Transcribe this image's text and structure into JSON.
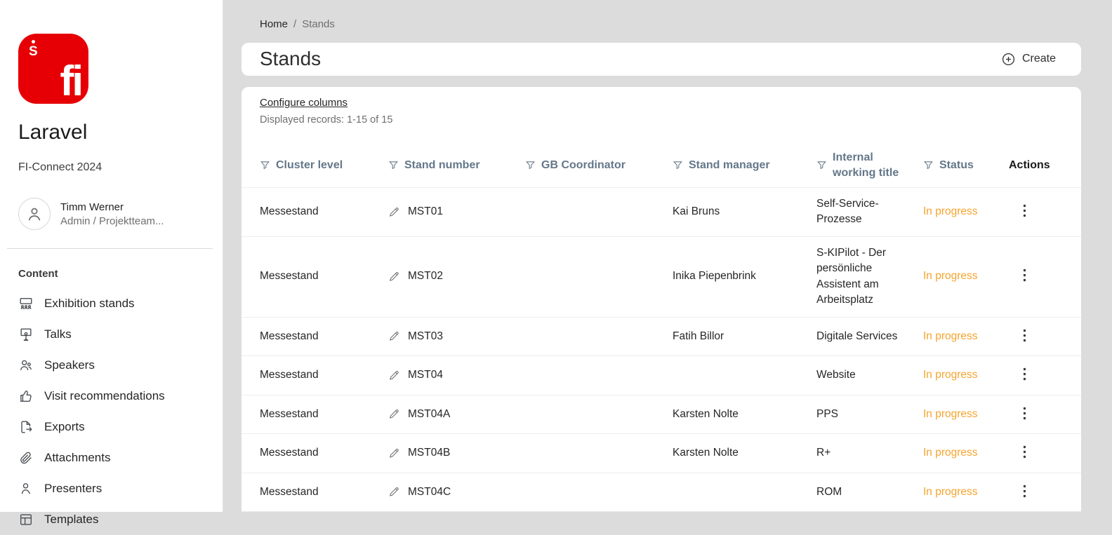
{
  "colors": {
    "brand_red": "#e60005",
    "status_orange": "#f5a42d",
    "window_bg": "#dcdcdc",
    "header_text": "#64778a"
  },
  "sidebar": {
    "logo": {
      "mark": "S",
      "text": "fi"
    },
    "app_title": "Laravel",
    "subtitle": "FI-Connect 2024",
    "user": {
      "name": "Timm Werner",
      "role": "Admin / Projektteam..."
    },
    "section": "Content",
    "items": [
      {
        "label": "Exhibition stands",
        "icon": "exhibition-stands-icon"
      },
      {
        "label": "Talks",
        "icon": "talks-icon"
      },
      {
        "label": "Speakers",
        "icon": "speakers-icon"
      },
      {
        "label": "Visit recommendations",
        "icon": "thumbs-up-icon"
      },
      {
        "label": "Exports",
        "icon": "export-icon"
      },
      {
        "label": "Attachments",
        "icon": "paperclip-icon"
      },
      {
        "label": "Presenters",
        "icon": "presenter-icon"
      },
      {
        "label": "Templates",
        "icon": "templates-icon"
      }
    ]
  },
  "breadcrumb": {
    "home": "Home",
    "separator": "/",
    "current": "Stands"
  },
  "page": {
    "title": "Stands",
    "create_label": "Create"
  },
  "table": {
    "configure_columns_label": "Configure columns",
    "records_info": "Displayed records: 1-15 of 15",
    "columns": [
      {
        "label": "Cluster level",
        "filterable": true
      },
      {
        "label": "Stand number",
        "filterable": true
      },
      {
        "label": "GB Coordinator",
        "filterable": true
      },
      {
        "label": "Stand manager",
        "filterable": true
      },
      {
        "label": "Internal working title",
        "filterable": true
      },
      {
        "label": "Status",
        "filterable": true
      },
      {
        "label": "Actions",
        "filterable": false
      }
    ],
    "rows": [
      {
        "cluster_level": "Messestand",
        "stand_number": "MST01",
        "gb_coordinator": "",
        "stand_manager": "Kai Bruns",
        "internal_working_title": "Self-Service-Prozesse",
        "status": "In progress"
      },
      {
        "cluster_level": "Messestand",
        "stand_number": "MST02",
        "gb_coordinator": "",
        "stand_manager": "Inika Piepenbrink",
        "internal_working_title": "S-KIPilot - Der persönliche Assistent am Arbeitsplatz",
        "status": "In progress"
      },
      {
        "cluster_level": "Messestand",
        "stand_number": "MST03",
        "gb_coordinator": "",
        "stand_manager": "Fatih Billor",
        "internal_working_title": "Digitale Services",
        "status": "In progress"
      },
      {
        "cluster_level": "Messestand",
        "stand_number": "MST04",
        "gb_coordinator": "",
        "stand_manager": "",
        "internal_working_title": "Website",
        "status": "In progress"
      },
      {
        "cluster_level": "Messestand",
        "stand_number": "MST04A",
        "gb_coordinator": "",
        "stand_manager": "Karsten Nolte",
        "internal_working_title": "PPS",
        "status": "In progress"
      },
      {
        "cluster_level": "Messestand",
        "stand_number": "MST04B",
        "gb_coordinator": "",
        "stand_manager": "Karsten Nolte",
        "internal_working_title": "R+",
        "status": "In progress"
      },
      {
        "cluster_level": "Messestand",
        "stand_number": "MST04C",
        "gb_coordinator": "",
        "stand_manager": "",
        "internal_working_title": "ROM",
        "status": "In progress"
      }
    ]
  }
}
